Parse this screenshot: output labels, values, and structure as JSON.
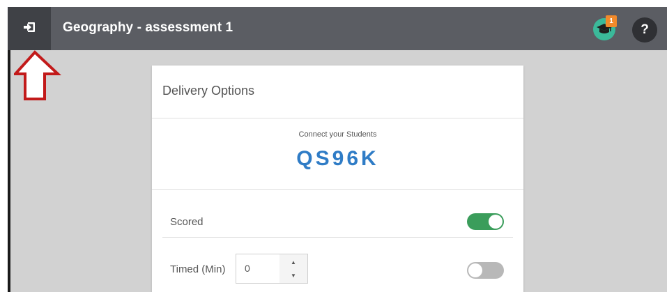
{
  "header": {
    "title": "Geography - assessment 1",
    "exit_icon": "sign-out-icon",
    "notification_count": "1",
    "help_label": "?"
  },
  "card": {
    "title": "Delivery Options",
    "connect_label": "Connect your Students",
    "room_code": "QS96K",
    "scored": {
      "label": "Scored",
      "enabled": true
    },
    "timed": {
      "label": "Timed (Min)",
      "value": "0",
      "enabled": false
    }
  },
  "colors": {
    "topbar": "#5b5d63",
    "exit_button": "#3f4146",
    "code": "#2f7cc6",
    "toggle_on": "#3b9d5b",
    "toggle_off": "#b8b8b8",
    "badge": "#f28a2b",
    "avatar": "#3bb99a",
    "annotation_arrow": "#c21a1a"
  }
}
